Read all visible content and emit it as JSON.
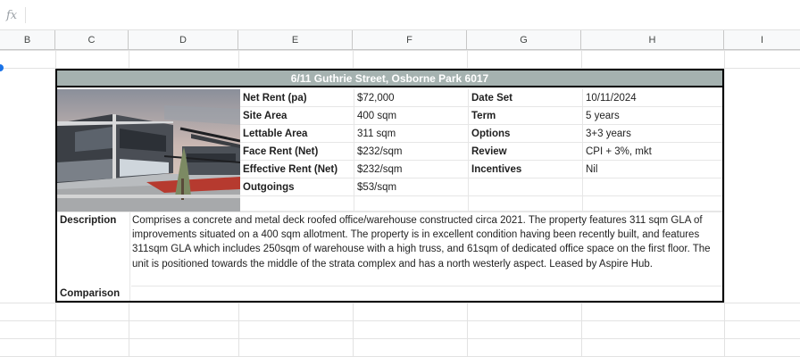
{
  "formula_bar": {
    "fx_label": "fx"
  },
  "columns": [
    "B",
    "C",
    "D",
    "E",
    "F",
    "G",
    "H",
    "I"
  ],
  "card": {
    "title": "6/11 Guthrie Street, Osborne Park 6017",
    "left_rows": [
      {
        "label": "Net Rent (pa)",
        "value": "$72,000"
      },
      {
        "label": "Site Area",
        "value": "400 sqm"
      },
      {
        "label": "Lettable Area",
        "value": "311 sqm"
      },
      {
        "label": "Face Rent (Net)",
        "value": "$232/sqm"
      },
      {
        "label": "Effective Rent (Net)",
        "value": "$232/sqm"
      },
      {
        "label": "Outgoings",
        "value": "$53/sqm"
      }
    ],
    "right_rows": [
      {
        "label": "Date Set",
        "value": "10/11/2024"
      },
      {
        "label": "Term",
        "value": "5 years"
      },
      {
        "label": "Options",
        "value": "3+3 years"
      },
      {
        "label": "Review",
        "value": "CPI + 3%, mkt"
      },
      {
        "label": "Incentives",
        "value": "Nil"
      },
      {
        "label": "",
        "value": ""
      }
    ],
    "description_label": "Description",
    "description_text": "Comprises a concrete and metal deck roofed office/warehouse constructed circa 2021. The property features 311 sqm GLA of improvements situated on a 400 sqm allotment. The property is in excellent condition having been recently built, and features 311sqm GLA which includes 250sqm of warehouse with a high truss, and 61sqm of dedicated office space on the first floor. The unit is positioned towards the middle of the strata complex and has a north westerly aspect. Leased by Aspire Hub.",
    "comparison_label": "Comparison",
    "comparison_text": ""
  },
  "colors": {
    "title_bar_bg": "#a5b2b0",
    "selection_accent": "#1a73e8"
  }
}
